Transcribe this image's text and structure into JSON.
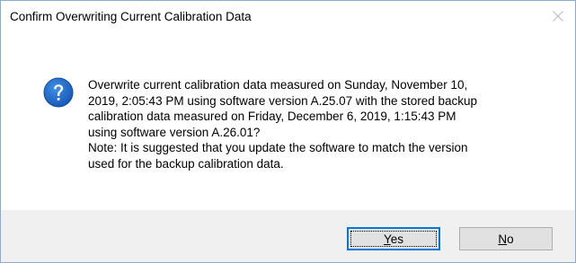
{
  "dialog": {
    "title": "Confirm Overwriting Current Calibration Data",
    "icon": "question-icon",
    "message_lines": [
      "Overwrite current calibration data measured on Sunday, November 10,",
      "2019, 2:05:43 PM using software version A.25.07 with the stored backup",
      "calibration data measured on Friday, December 6, 2019, 1:15:43 PM",
      "using software version A.26.01?",
      "Note: It is suggested that you update the software to match the version",
      "used for the backup calibration data."
    ],
    "buttons": {
      "yes": {
        "mnemonic": "Y",
        "rest": "es"
      },
      "no": {
        "mnemonic": "N",
        "rest": "o"
      }
    },
    "colors": {
      "icon_blue": "#1e63c6",
      "default_button_border": "#0078d7",
      "footer_bg": "#f0f0f0"
    }
  }
}
